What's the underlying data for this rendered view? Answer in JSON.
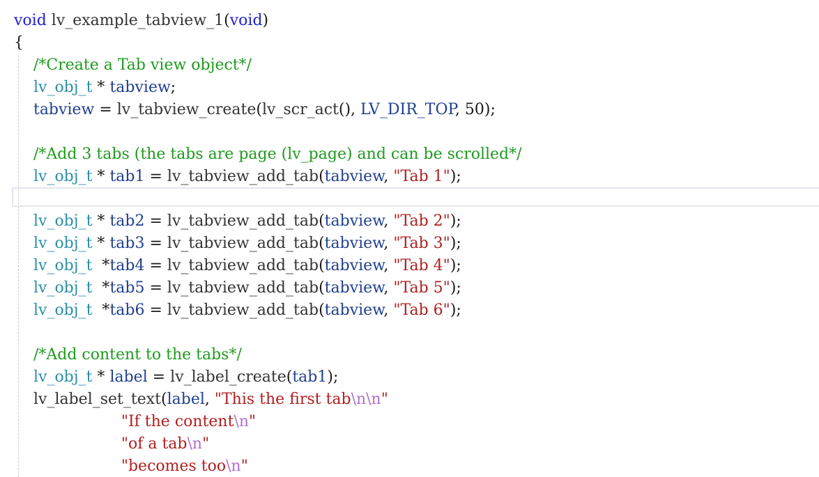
{
  "editor": {
    "lines": [
      [
        {
          "t": "void",
          "c": "kw"
        },
        {
          "t": " lv_example_tabview_1",
          "c": "fn"
        },
        {
          "t": "(",
          "c": "pn"
        },
        {
          "t": "void",
          "c": "kw"
        },
        {
          "t": ")",
          "c": "pn"
        }
      ],
      [
        {
          "t": "{",
          "c": "pn"
        }
      ],
      [
        {
          "t": "    /*Create a Tab view object*/",
          "c": "cm"
        }
      ],
      [
        {
          "t": "    lv_obj_t",
          "c": "ty"
        },
        {
          "t": " * ",
          "c": "pn"
        },
        {
          "t": "tabview",
          "c": "id"
        },
        {
          "t": ";",
          "c": "pn"
        }
      ],
      [
        {
          "t": "    tabview",
          "c": "id"
        },
        {
          "t": " = ",
          "c": "pn"
        },
        {
          "t": "lv_tabview_create",
          "c": "fn"
        },
        {
          "t": "(",
          "c": "pn"
        },
        {
          "t": "lv_scr_act",
          "c": "fn"
        },
        {
          "t": "(), ",
          "c": "pn"
        },
        {
          "t": "LV_DIR_TOP",
          "c": "id"
        },
        {
          "t": ", ",
          "c": "pn"
        },
        {
          "t": "50",
          "c": "nm"
        },
        {
          "t": ");",
          "c": "pn"
        }
      ],
      [],
      [
        {
          "t": "    /*Add 3 tabs (the tabs are page (lv_page) and can be scrolled*/",
          "c": "cm"
        }
      ],
      [
        {
          "t": "    lv_obj_t",
          "c": "ty"
        },
        {
          "t": " * ",
          "c": "pn"
        },
        {
          "t": "tab1",
          "c": "id"
        },
        {
          "t": " = ",
          "c": "pn"
        },
        {
          "t": "lv_tabview_add_tab",
          "c": "fn"
        },
        {
          "t": "(",
          "c": "pn"
        },
        {
          "t": "tabview",
          "c": "id"
        },
        {
          "t": ", ",
          "c": "pn"
        },
        {
          "t": "\"Tab 1\"",
          "c": "st"
        },
        {
          "t": ");",
          "c": "pn"
        }
      ],
      [],
      [
        {
          "t": "    lv_obj_t",
          "c": "ty"
        },
        {
          "t": " * ",
          "c": "pn"
        },
        {
          "t": "tab2",
          "c": "id"
        },
        {
          "t": " = ",
          "c": "pn"
        },
        {
          "t": "lv_tabview_add_tab",
          "c": "fn"
        },
        {
          "t": "(",
          "c": "pn"
        },
        {
          "t": "tabview",
          "c": "id"
        },
        {
          "t": ", ",
          "c": "pn"
        },
        {
          "t": "\"Tab 2\"",
          "c": "st"
        },
        {
          "t": ");",
          "c": "pn"
        }
      ],
      [
        {
          "t": "    lv_obj_t",
          "c": "ty"
        },
        {
          "t": " * ",
          "c": "pn"
        },
        {
          "t": "tab3",
          "c": "id"
        },
        {
          "t": " = ",
          "c": "pn"
        },
        {
          "t": "lv_tabview_add_tab",
          "c": "fn"
        },
        {
          "t": "(",
          "c": "pn"
        },
        {
          "t": "tabview",
          "c": "id"
        },
        {
          "t": ", ",
          "c": "pn"
        },
        {
          "t": "\"Tab 3\"",
          "c": "st"
        },
        {
          "t": ");",
          "c": "pn"
        }
      ],
      [
        {
          "t": "    lv_obj_t",
          "c": "ty"
        },
        {
          "t": "  *",
          "c": "pn"
        },
        {
          "t": "tab4",
          "c": "id"
        },
        {
          "t": " = ",
          "c": "pn"
        },
        {
          "t": "lv_tabview_add_tab",
          "c": "fn"
        },
        {
          "t": "(",
          "c": "pn"
        },
        {
          "t": "tabview",
          "c": "id"
        },
        {
          "t": ", ",
          "c": "pn"
        },
        {
          "t": "\"Tab 4\"",
          "c": "st"
        },
        {
          "t": ");",
          "c": "pn"
        }
      ],
      [
        {
          "t": "    lv_obj_t",
          "c": "ty"
        },
        {
          "t": "  *",
          "c": "pn"
        },
        {
          "t": "tab5",
          "c": "id"
        },
        {
          "t": " = ",
          "c": "pn"
        },
        {
          "t": "lv_tabview_add_tab",
          "c": "fn"
        },
        {
          "t": "(",
          "c": "pn"
        },
        {
          "t": "tabview",
          "c": "id"
        },
        {
          "t": ", ",
          "c": "pn"
        },
        {
          "t": "\"Tab 5\"",
          "c": "st"
        },
        {
          "t": ");",
          "c": "pn"
        }
      ],
      [
        {
          "t": "    lv_obj_t",
          "c": "ty"
        },
        {
          "t": "  *",
          "c": "pn"
        },
        {
          "t": "tab6",
          "c": "id"
        },
        {
          "t": " = ",
          "c": "pn"
        },
        {
          "t": "lv_tabview_add_tab",
          "c": "fn"
        },
        {
          "t": "(",
          "c": "pn"
        },
        {
          "t": "tabview",
          "c": "id"
        },
        {
          "t": ", ",
          "c": "pn"
        },
        {
          "t": "\"Tab 6\"",
          "c": "st"
        },
        {
          "t": ");",
          "c": "pn"
        }
      ],
      [],
      [
        {
          "t": "    /*Add content to the tabs*/",
          "c": "cm"
        }
      ],
      [
        {
          "t": "    lv_obj_t",
          "c": "ty"
        },
        {
          "t": " * ",
          "c": "pn"
        },
        {
          "t": "label",
          "c": "id"
        },
        {
          "t": " = ",
          "c": "pn"
        },
        {
          "t": "lv_label_create",
          "c": "fn"
        },
        {
          "t": "(",
          "c": "pn"
        },
        {
          "t": "tab1",
          "c": "id"
        },
        {
          "t": ");",
          "c": "pn"
        }
      ],
      [
        {
          "t": "    lv_label_set_text",
          "c": "fn"
        },
        {
          "t": "(",
          "c": "pn"
        },
        {
          "t": "label",
          "c": "id"
        },
        {
          "t": ", ",
          "c": "pn"
        },
        {
          "t": "\"This the first tab",
          "c": "st"
        },
        {
          "t": "\\n\\n",
          "c": "es"
        },
        {
          "t": "\"",
          "c": "st"
        }
      ],
      [
        {
          "t": "                      \"If the content",
          "c": "st"
        },
        {
          "t": "\\n",
          "c": "es"
        },
        {
          "t": "\"",
          "c": "st"
        }
      ],
      [
        {
          "t": "                      \"of a tab",
          "c": "st"
        },
        {
          "t": "\\n",
          "c": "es"
        },
        {
          "t": "\"",
          "c": "st"
        }
      ],
      [
        {
          "t": "                      \"becomes too",
          "c": "st"
        },
        {
          "t": "\\n",
          "c": "es"
        },
        {
          "t": "\"",
          "c": "st"
        }
      ]
    ]
  }
}
